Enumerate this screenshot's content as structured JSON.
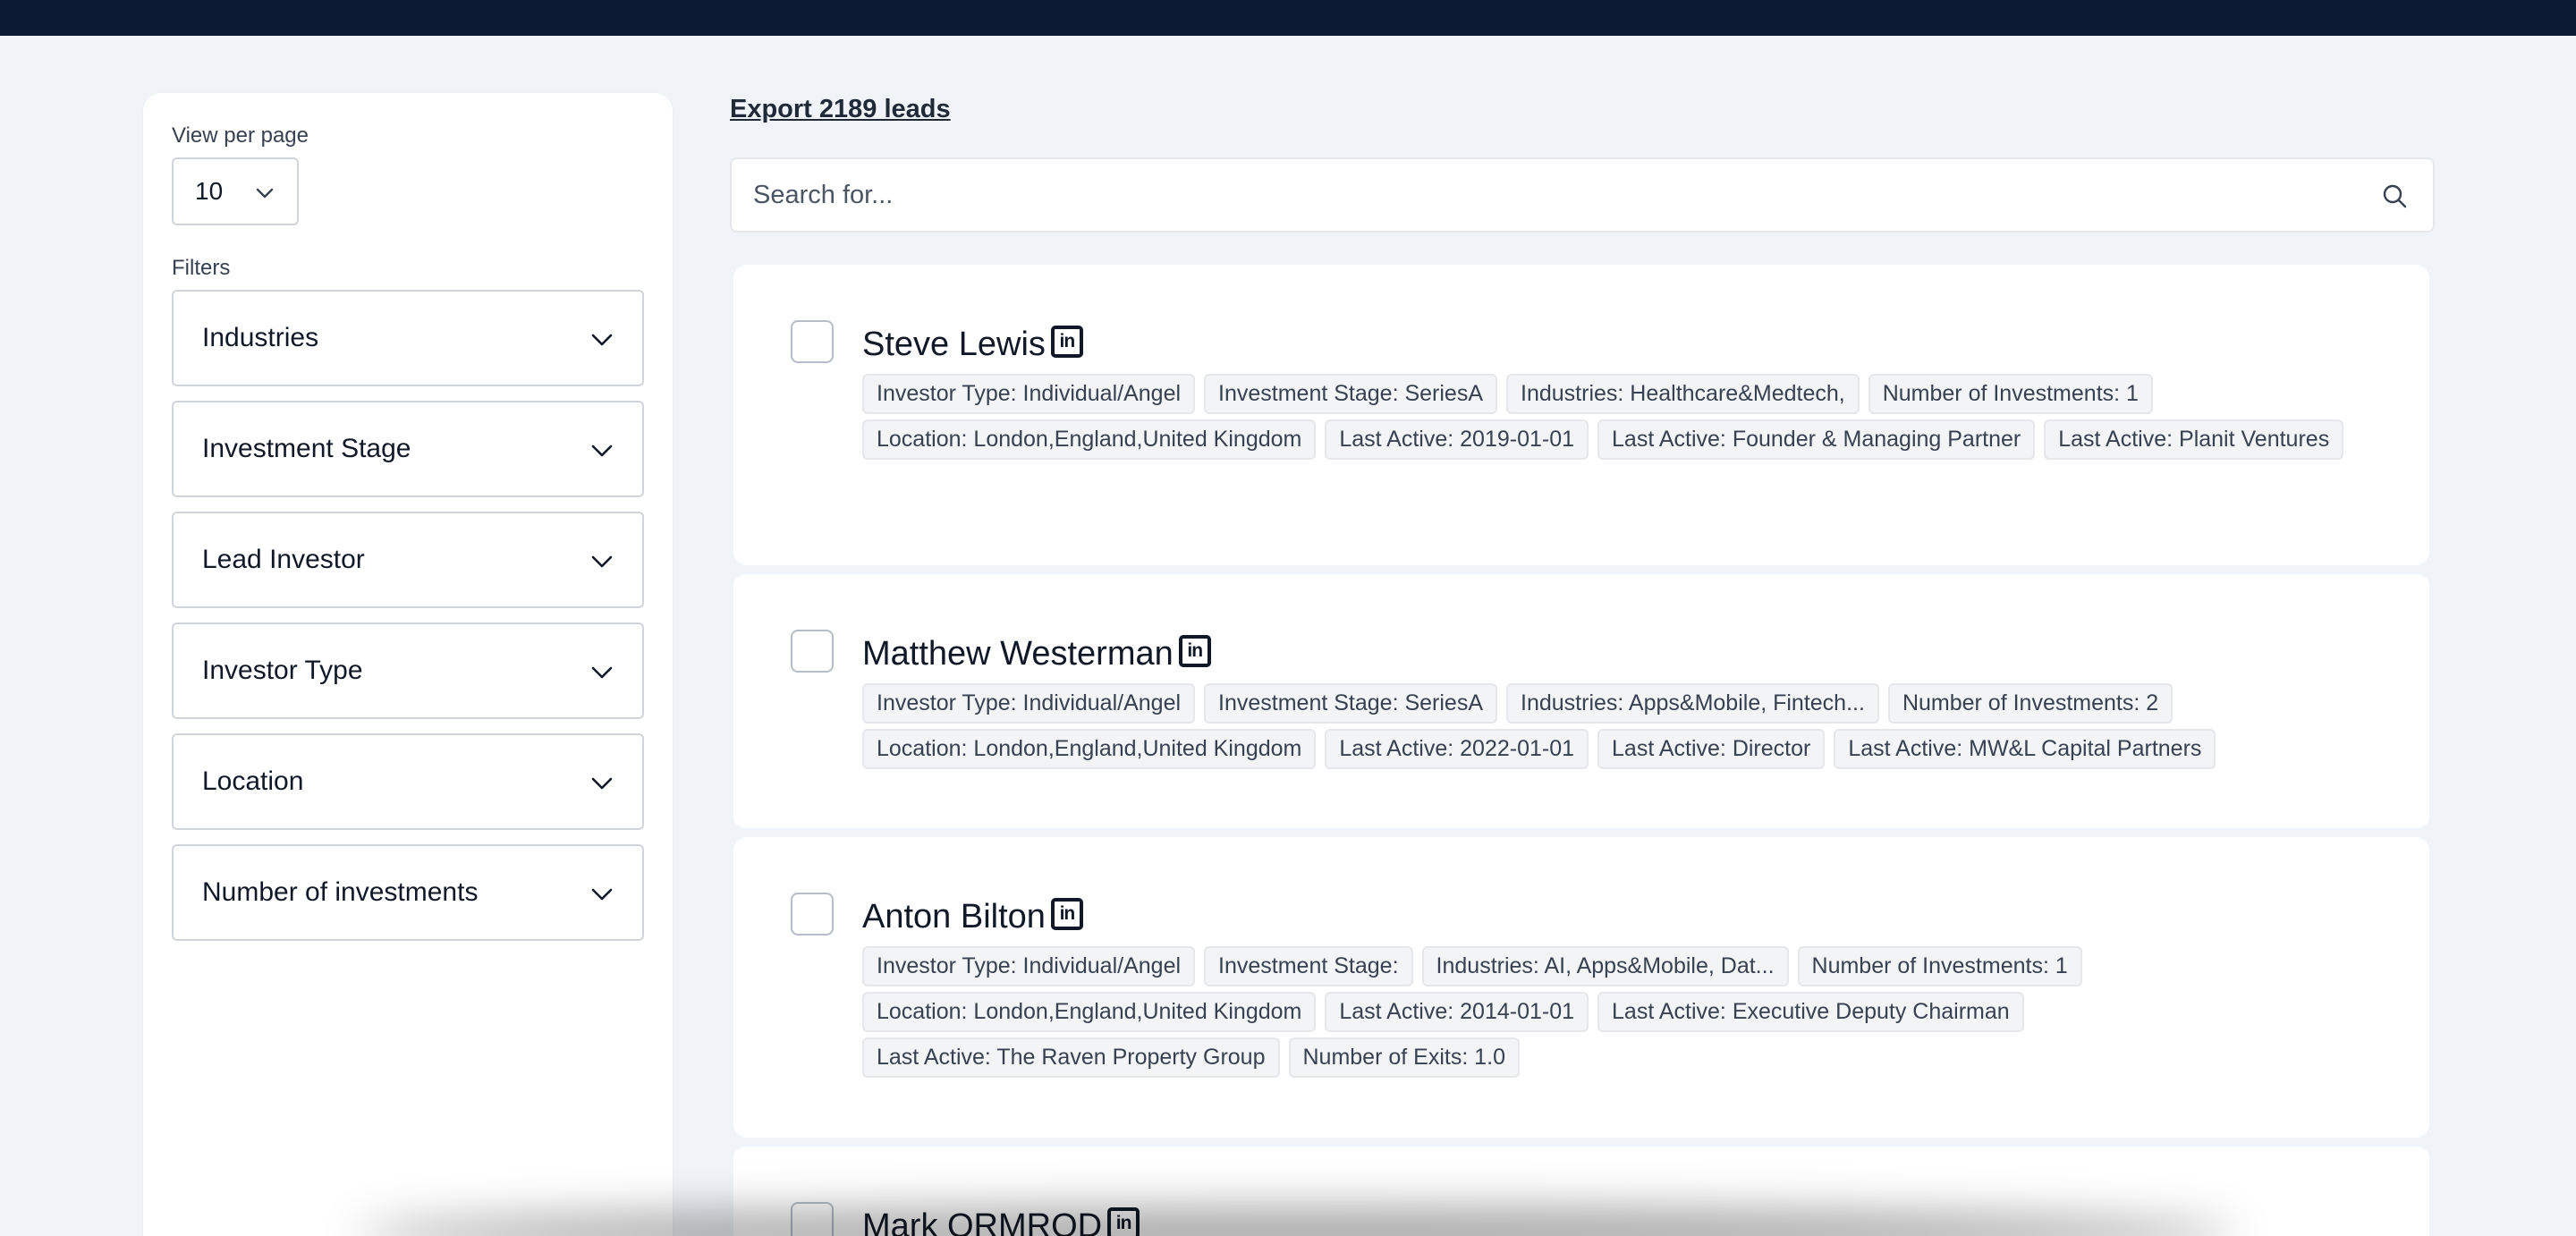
{
  "sidebar": {
    "per_page_label": "View per page",
    "per_page_value": "10",
    "filters_label": "Filters",
    "filters": [
      {
        "label": "Industries"
      },
      {
        "label": "Investment Stage"
      },
      {
        "label": "Lead Investor"
      },
      {
        "label": "Investor Type"
      },
      {
        "label": "Location"
      },
      {
        "label": "Number of investments"
      }
    ]
  },
  "main": {
    "export_label": "Export 2189 leads",
    "search_placeholder": "Search for..."
  },
  "investors": [
    {
      "name": "Steve Lewis",
      "tags": [
        "Investor Type: Individual/Angel",
        "Investment Stage: SeriesA",
        "Industries: Healthcare&Medtech,",
        "Number of Investments: 1",
        "Location: London,England,United Kingdom",
        "Last Active: 2019-01-01",
        "Last Active: Founder & Managing Partner",
        "Last Active: Planit Ventures"
      ]
    },
    {
      "name": "Matthew Westerman",
      "tags": [
        "Investor Type: Individual/Angel",
        "Investment Stage: SeriesA",
        "Industries: Apps&Mobile, Fintech...",
        "Number of Investments: 2",
        "Location: London,England,United Kingdom",
        "Last Active: 2022-01-01",
        "Last Active: Director",
        "Last Active: MW&L Capital Partners"
      ]
    },
    {
      "name": "Anton Bilton",
      "tags": [
        "Investor Type: Individual/Angel",
        "Investment Stage:",
        "Industries: AI, Apps&Mobile, Dat...",
        "Number of Investments: 1",
        "Location: London,England,United Kingdom",
        "Last Active: 2014-01-01",
        "Last Active: Executive Deputy Chairman",
        "Last Active: The Raven Property Group",
        "Number of Exits: 1.0"
      ]
    },
    {
      "name": "Mark ORMROD",
      "tags": []
    }
  ],
  "icons": {
    "linkedin": "linkedin-icon",
    "chevron": "chevron-down-icon",
    "search": "search-icon"
  },
  "colors": {
    "topbar": "#0c1a33",
    "background": "#f0f4f8",
    "card": "#ffffff",
    "tag_bg": "#f3f4f6"
  }
}
